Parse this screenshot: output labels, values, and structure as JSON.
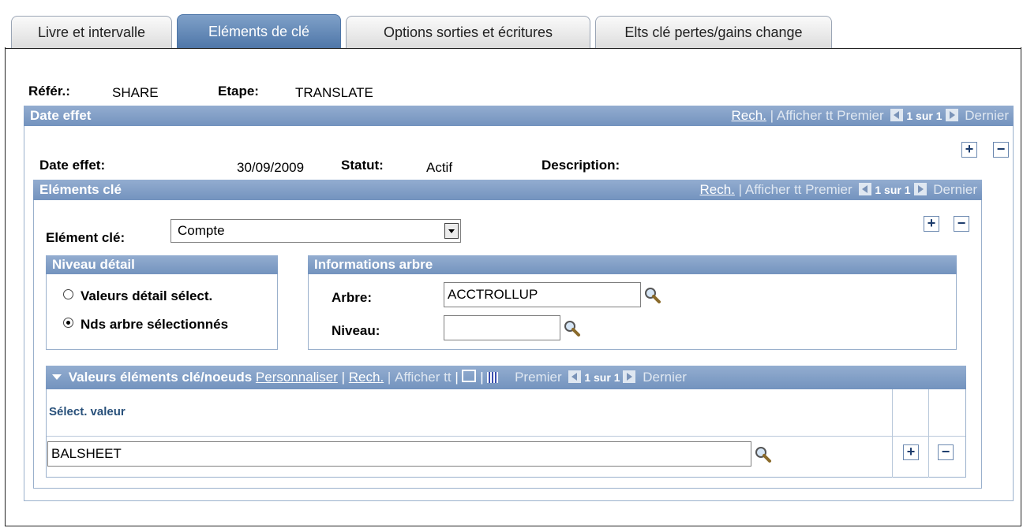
{
  "tabs": [
    {
      "label": "Livre et intervalle",
      "active": false
    },
    {
      "label": "Eléments de clé",
      "active": true
    },
    {
      "label": "Options sorties et écritures",
      "active": false
    },
    {
      "label": "Elts clé pertes/gains change",
      "active": false
    }
  ],
  "header": {
    "refer_label": "Référ.:",
    "refer_value": "SHARE",
    "etape_label": "Etape:",
    "etape_value": "TRANSLATE"
  },
  "date_effet_section": {
    "title": "Date effet",
    "nav": {
      "rech": "Rech.",
      "sep": "|",
      "afficher": "Afficher tt",
      "premier": "Premier",
      "count": "1 sur 1",
      "dernier": "Dernier"
    },
    "date_label": "Date effet:",
    "date_value": "30/09/2009",
    "statut_label": "Statut:",
    "statut_value": "Actif",
    "description_label": "Description:",
    "add": "+",
    "remove": "−"
  },
  "elements_section": {
    "title": "Eléments clé",
    "nav": {
      "rech": "Rech.",
      "sep": "|",
      "afficher": "Afficher tt",
      "premier": "Premier",
      "count": "1 sur 1",
      "dernier": "Dernier"
    },
    "element_label": "Elément clé:",
    "element_value": "Compte",
    "add": "+",
    "remove": "−"
  },
  "niveau_detail": {
    "title": "Niveau détail",
    "option1": "Valeurs détail sélect.",
    "option2": "Nds arbre sélectionnés",
    "selected": "option2"
  },
  "informations_arbre": {
    "title": "Informations arbre",
    "arbre_label": "Arbre:",
    "arbre_value": "ACCTROLLUP",
    "niveau_label": "Niveau:",
    "niveau_value": ""
  },
  "valeurs_grid": {
    "title": "Valeurs éléments clé/noeuds",
    "personnaliser": "Personnaliser",
    "sep": "|",
    "rech": "Rech.",
    "afficher": "Afficher tt",
    "premier": "Premier",
    "count": "1 sur 1",
    "dernier": "Dernier",
    "column_header": "Sélect. valeur",
    "rows": [
      {
        "value": "BALSHEET"
      }
    ],
    "add": "+",
    "remove": "−"
  }
}
